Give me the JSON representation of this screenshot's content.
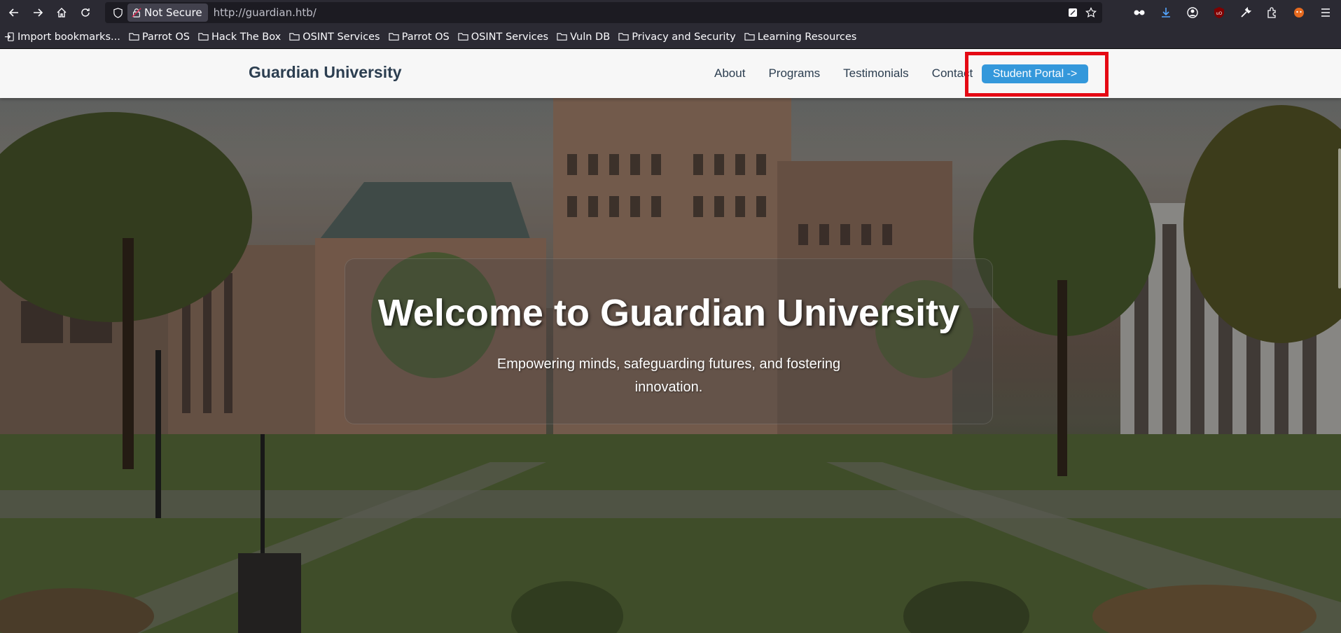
{
  "browser": {
    "security_label": "Not Secure",
    "url": "http://guardian.htb/",
    "bookmarks": [
      {
        "label": "Import bookmarks..."
      },
      {
        "label": "Parrot OS"
      },
      {
        "label": "Hack The Box"
      },
      {
        "label": "OSINT Services"
      },
      {
        "label": "Parrot OS"
      },
      {
        "label": "OSINT Services"
      },
      {
        "label": "Vuln DB"
      },
      {
        "label": "Privacy and Security"
      },
      {
        "label": "Learning Resources"
      }
    ]
  },
  "site": {
    "brand": "Guardian University",
    "nav": {
      "about": "About",
      "programs": "Programs",
      "testimonials": "Testimonials",
      "contact": "Contact"
    },
    "portal_button": "Student Portal ->",
    "accent_color": "#3498db",
    "highlight_color": "#e50914"
  },
  "hero": {
    "title": "Welcome to Guardian University",
    "subtitle": "Empowering minds, safeguarding futures, and fostering innovation."
  }
}
